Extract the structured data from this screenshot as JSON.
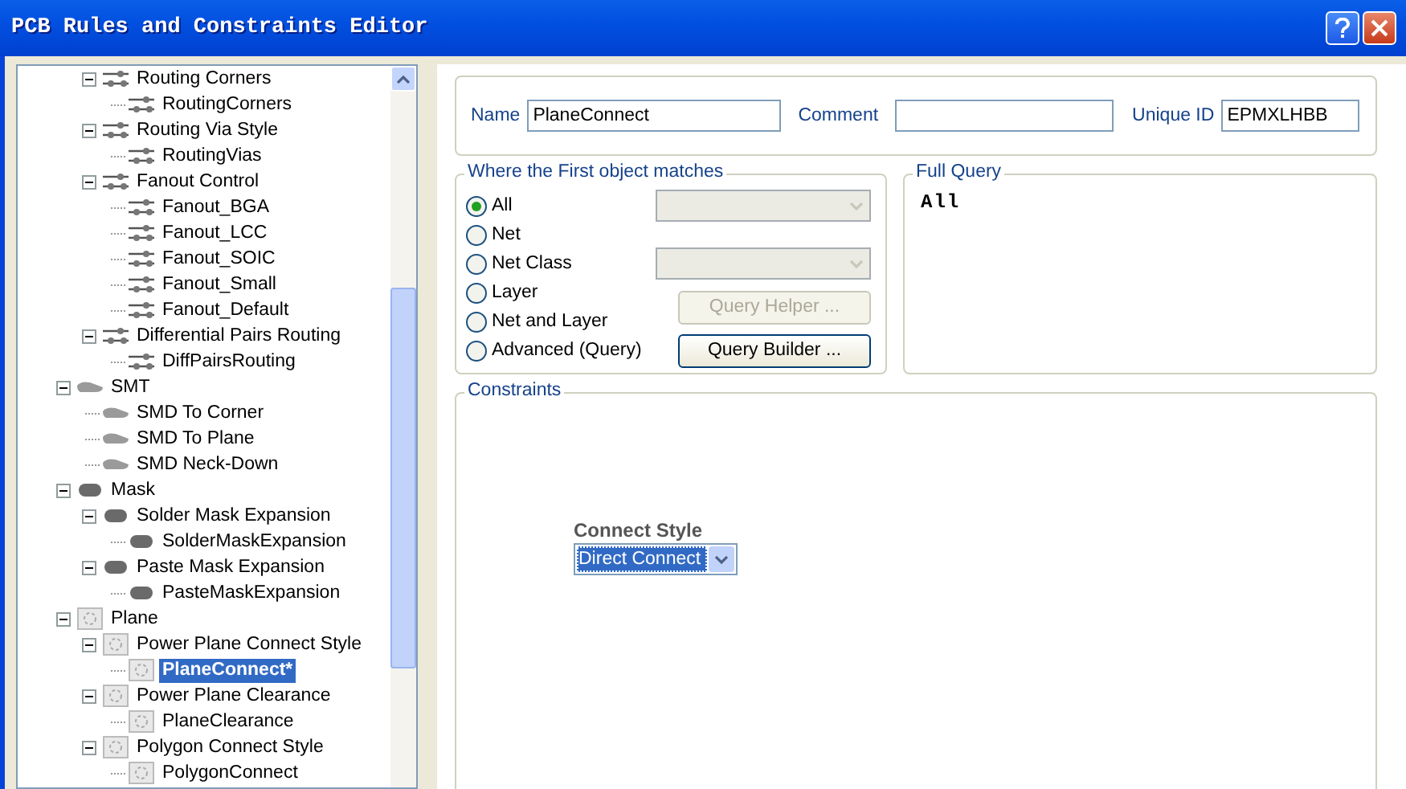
{
  "window": {
    "title": "PCB Rules and Constraints Editor"
  },
  "tree": {
    "items": [
      {
        "children": [
          {
            "label": "Routing Corners",
            "kind": "routing",
            "expanded": true,
            "selected": false,
            "children": [
              {
                "label": "RoutingCorners",
                "kind": "routing",
                "selected": false
              }
            ]
          },
          {
            "label": "Routing Via Style",
            "kind": "routing",
            "expanded": true,
            "selected": false,
            "children": [
              {
                "label": "RoutingVias",
                "kind": "routing",
                "selected": false
              }
            ]
          },
          {
            "label": "Fanout Control",
            "kind": "routing",
            "expanded": true,
            "selected": false,
            "children": [
              {
                "label": "Fanout_BGA",
                "kind": "routing",
                "selected": false
              },
              {
                "label": "Fanout_LCC",
                "kind": "routing",
                "selected": false
              },
              {
                "label": "Fanout_SOIC",
                "kind": "routing",
                "selected": false
              },
              {
                "label": "Fanout_Small",
                "kind": "routing",
                "selected": false
              },
              {
                "label": "Fanout_Default",
                "kind": "routing",
                "selected": false
              }
            ]
          },
          {
            "label": "Differential Pairs Routing",
            "kind": "routing",
            "expanded": true,
            "selected": false,
            "children": [
              {
                "label": "DiffPairsRouting",
                "kind": "routing",
                "selected": false
              }
            ]
          }
        ]
      },
      {
        "label": "SMT",
        "kind": "smt",
        "expanded": true,
        "selected": false,
        "children": [
          {
            "label": "SMD To Corner",
            "kind": "smt",
            "selected": false
          },
          {
            "label": "SMD To Plane",
            "kind": "smt",
            "selected": false
          },
          {
            "label": "SMD Neck-Down",
            "kind": "smt",
            "selected": false
          }
        ]
      },
      {
        "label": "Mask",
        "kind": "mask",
        "expanded": true,
        "selected": false,
        "children": [
          {
            "label": "Solder Mask Expansion",
            "kind": "mask",
            "expanded": true,
            "selected": false,
            "children": [
              {
                "label": "SolderMaskExpansion",
                "kind": "mask",
                "selected": false
              }
            ]
          },
          {
            "label": "Paste Mask Expansion",
            "kind": "mask",
            "expanded": true,
            "selected": false,
            "children": [
              {
                "label": "PasteMaskExpansion",
                "kind": "mask",
                "selected": false
              }
            ]
          }
        ]
      },
      {
        "label": "Plane",
        "kind": "plane",
        "expanded": true,
        "selected": false,
        "children": [
          {
            "label": "Power Plane Connect Style",
            "kind": "plane",
            "expanded": true,
            "selected": false,
            "children": [
              {
                "label": "PlaneConnect*",
                "kind": "plane",
                "selected": true
              }
            ]
          },
          {
            "label": "Power Plane Clearance",
            "kind": "plane",
            "expanded": true,
            "selected": false,
            "children": [
              {
                "label": "PlaneClearance",
                "kind": "plane",
                "selected": false
              }
            ]
          },
          {
            "label": "Polygon Connect Style",
            "kind": "plane",
            "expanded": true,
            "selected": false,
            "children": [
              {
                "label": "PolygonConnect",
                "kind": "plane",
                "selected": false
              }
            ]
          }
        ]
      }
    ]
  },
  "rule": {
    "name_label": "Name",
    "name": "PlaneConnect",
    "comment_label": "Comment",
    "unique_id_label": "Unique ID",
    "unique_id": "EPMXLHBB"
  },
  "first_object": {
    "title": "Where the First object matches",
    "options": [
      {
        "label": "All",
        "selected": true
      },
      {
        "label": "Net",
        "selected": false
      },
      {
        "label": "Net Class",
        "selected": false
      },
      {
        "label": "Layer",
        "selected": false
      },
      {
        "label": "Net and Layer",
        "selected": false
      },
      {
        "label": "Advanced (Query)",
        "selected": false
      }
    ],
    "dropdowns": [
      {
        "disabled": true
      },
      {
        "disabled": true
      }
    ],
    "buttons": [
      {
        "label": "Query Helper ...",
        "disabled": true
      },
      {
        "label": "Query Builder ...",
        "disabled": false
      }
    ]
  },
  "full_query": {
    "title": "Full Query",
    "text": "All"
  },
  "constraints": {
    "title": "Constraints",
    "connect_style": {
      "label": "Connect Style",
      "value": "Direct Connect"
    }
  }
}
